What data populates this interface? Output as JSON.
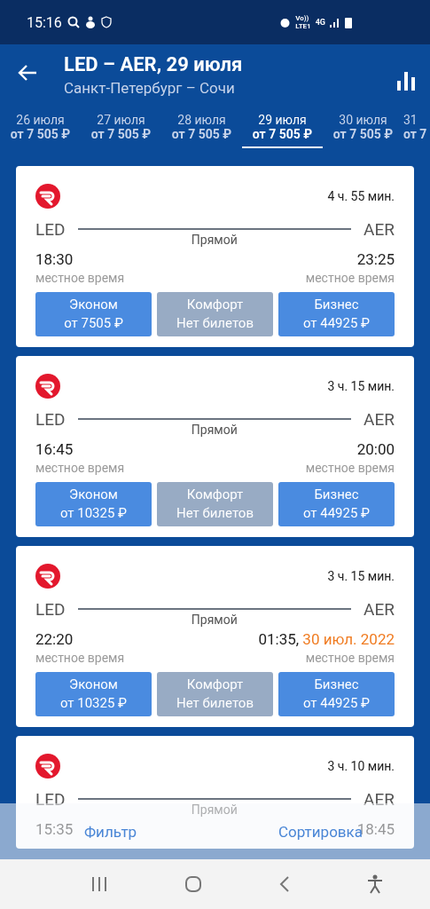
{
  "status_bar": {
    "time": "15:16",
    "volte_top": "Vo))",
    "volte_bottom": "LTE1",
    "network": "4G"
  },
  "header": {
    "title": "LED – AER, 29 июля",
    "subtitle": "Санкт-Петербург – Сочи"
  },
  "date_tabs": [
    {
      "date": "26 июля",
      "price": "от 7 505 ₽",
      "selected": false
    },
    {
      "date": "27 июля",
      "price": "от 7 505 ₽",
      "selected": false
    },
    {
      "date": "28 июля",
      "price": "от 7 505 ₽",
      "selected": false
    },
    {
      "date": "29 июля",
      "price": "от 7 505 ₽",
      "selected": true
    },
    {
      "date": "30 июля",
      "price": "от 7 505 ₽",
      "selected": false
    },
    {
      "date": "31",
      "price": "от 7",
      "selected": false
    }
  ],
  "flights": [
    {
      "duration": "4 ч. 55 мин.",
      "from": "LED",
      "to": "AER",
      "stops": "Прямой",
      "departure": "18:30",
      "arrival": "23:25",
      "departure_note": "местное время",
      "arrival_note": "местное время",
      "fares": [
        {
          "name": "Эконом",
          "price": "от 7505 ₽",
          "available": true
        },
        {
          "name": "Комфорт",
          "price": "Нет билетов",
          "available": false
        },
        {
          "name": "Бизнес",
          "price": "от 44925 ₽",
          "available": true
        }
      ]
    },
    {
      "duration": "3 ч. 15 мин.",
      "from": "LED",
      "to": "AER",
      "stops": "Прямой",
      "departure": "16:45",
      "arrival": "20:00",
      "departure_note": "местное время",
      "arrival_note": "местное время",
      "fares": [
        {
          "name": "Эконом",
          "price": "от 10325 ₽",
          "available": true
        },
        {
          "name": "Комфорт",
          "price": "Нет билетов",
          "available": false
        },
        {
          "name": "Бизнес",
          "price": "от 44925 ₽",
          "available": true
        }
      ]
    },
    {
      "duration": "3 ч. 15 мин.",
      "from": "LED",
      "to": "AER",
      "stops": "Прямой",
      "departure": "22:20",
      "arrival": "01:35,",
      "arrival_date": "30 июл. 2022",
      "departure_note": "местное время",
      "arrival_note": "местное время",
      "fares": [
        {
          "name": "Эконом",
          "price": "от 10325 ₽",
          "available": true
        },
        {
          "name": "Комфорт",
          "price": "Нет билетов",
          "available": false
        },
        {
          "name": "Бизнес",
          "price": "от 44925 ₽",
          "available": true
        }
      ]
    },
    {
      "duration": "3 ч. 10 мин.",
      "from": "LED",
      "to": "AER",
      "stops": "Прямой",
      "departure": "15:35",
      "arrival": "18:45"
    }
  ],
  "bottom_bar": {
    "filter": "Фильтр",
    "sort": "Сортировка"
  }
}
